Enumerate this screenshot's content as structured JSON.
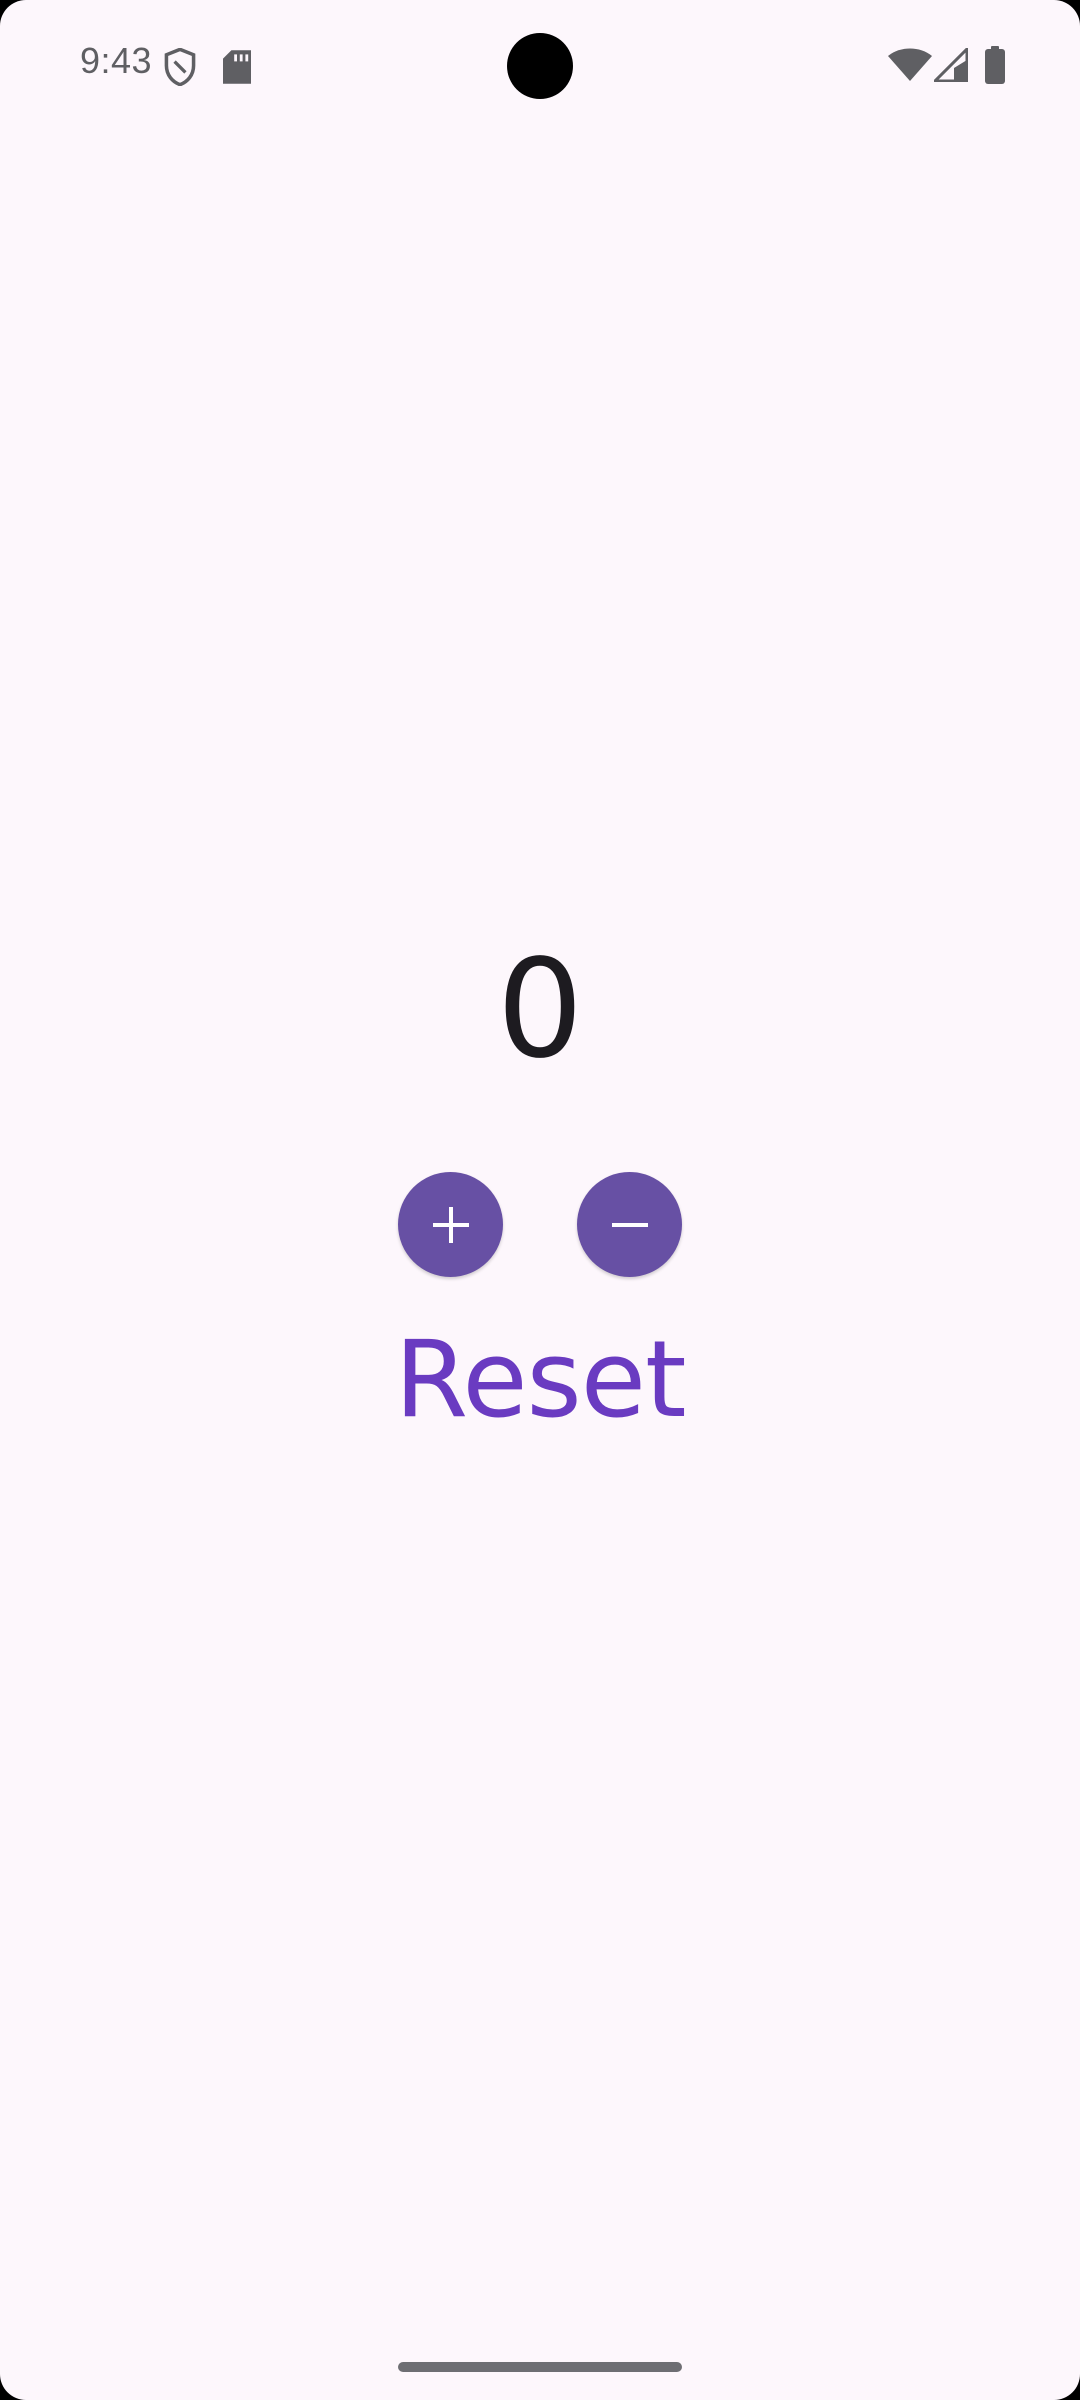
{
  "status_bar": {
    "time": "9:43",
    "icons": [
      "shield-icon",
      "sd-card-icon",
      "wifi-icon",
      "cell-signal-icon",
      "battery-icon"
    ]
  },
  "counter": {
    "value": "0"
  },
  "controls": {
    "increment_icon": "plus-icon",
    "decrement_icon": "minus-icon",
    "reset_label": "Reset"
  },
  "colors": {
    "background": "#FDF7FC",
    "button_fill": "#6750A4",
    "reset_text": "#6A3BC1",
    "counter_text": "#1D1B20"
  }
}
